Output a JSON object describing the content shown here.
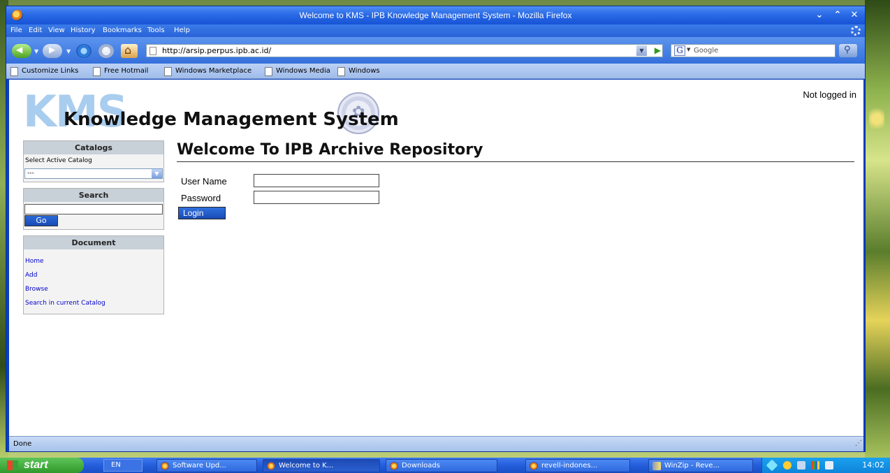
{
  "window": {
    "title": "Welcome to KMS - IPB Knowledge Management System - Mozilla Firefox",
    "controls": [
      "⌄",
      "⌃",
      "✕"
    ]
  },
  "menubar": [
    "File",
    "Edit",
    "View",
    "History",
    "Bookmarks",
    "Tools",
    "Help"
  ],
  "navbar": {
    "url": "http://arsip.perpus.ipb.ac.id/",
    "search_engine": "Google"
  },
  "bookmarks": [
    "Customize Links",
    "Free Hotmail",
    "Windows Marketplace",
    "Windows Media",
    "Windows"
  ],
  "page": {
    "logo_letters": "KMS",
    "logo_full": "Knowledge Management System",
    "login_status": "Not logged in",
    "sidebar": {
      "catalogs": {
        "title": "Catalogs",
        "label": "Select Active Catalog",
        "selected": "---"
      },
      "search": {
        "title": "Search",
        "go_label": "Go"
      },
      "document": {
        "title": "Document",
        "links": [
          "Home",
          "Add",
          "Browse",
          "Search in current Catalog"
        ]
      }
    },
    "main": {
      "title": "Welcome To IPB Archive Repository",
      "username_label": "User Name",
      "password_label": "Password",
      "login_label": "Login"
    }
  },
  "statusbar": {
    "text": "Done"
  },
  "taskbar": {
    "start_label": "start",
    "language": "EN",
    "tasks": [
      "Software Upd...",
      "Welcome to K...",
      "Downloads",
      "revell-indones...",
      "WinZip - Reve..."
    ],
    "active_task_index": 1,
    "clock": "14:02"
  }
}
